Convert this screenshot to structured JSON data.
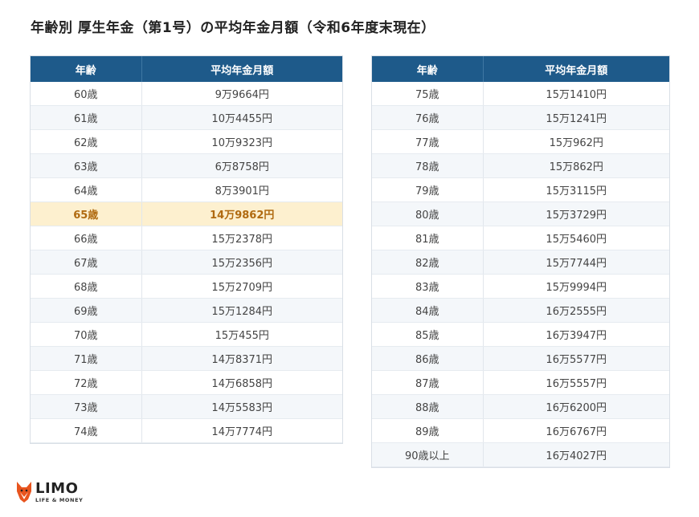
{
  "title": "年齢別 厚生年金（第1号）の平均年金月額（令和6年度末現在）",
  "headers": {
    "age": "年齢",
    "amount": "平均年金月額"
  },
  "left_table": [
    {
      "age": "60歳",
      "amount": "9万9664円"
    },
    {
      "age": "61歳",
      "amount": "10万4455円"
    },
    {
      "age": "62歳",
      "amount": "10万9323円"
    },
    {
      "age": "63歳",
      "amount": "6万8758円"
    },
    {
      "age": "64歳",
      "amount": "8万3901円"
    },
    {
      "age": "65歳",
      "amount": "14万9862円",
      "highlight": true
    },
    {
      "age": "66歳",
      "amount": "15万2378円"
    },
    {
      "age": "67歳",
      "amount": "15万2356円"
    },
    {
      "age": "68歳",
      "amount": "15万2709円"
    },
    {
      "age": "69歳",
      "amount": "15万1284円"
    },
    {
      "age": "70歳",
      "amount": "15万455円"
    },
    {
      "age": "71歳",
      "amount": "14万8371円"
    },
    {
      "age": "72歳",
      "amount": "14万6858円"
    },
    {
      "age": "73歳",
      "amount": "14万5583円"
    },
    {
      "age": "74歳",
      "amount": "14万7774円"
    }
  ],
  "right_table": [
    {
      "age": "75歳",
      "amount": "15万1410円"
    },
    {
      "age": "76歳",
      "amount": "15万1241円"
    },
    {
      "age": "77歳",
      "amount": "15万962円"
    },
    {
      "age": "78歳",
      "amount": "15万862円"
    },
    {
      "age": "79歳",
      "amount": "15万3115円"
    },
    {
      "age": "80歳",
      "amount": "15万3729円"
    },
    {
      "age": "81歳",
      "amount": "15万5460円"
    },
    {
      "age": "82歳",
      "amount": "15万7744円"
    },
    {
      "age": "83歳",
      "amount": "15万9994円"
    },
    {
      "age": "84歳",
      "amount": "16万2555円"
    },
    {
      "age": "85歳",
      "amount": "16万3947円"
    },
    {
      "age": "86歳",
      "amount": "16万5577円"
    },
    {
      "age": "87歳",
      "amount": "16万5557円"
    },
    {
      "age": "88歳",
      "amount": "16万6200円"
    },
    {
      "age": "89歳",
      "amount": "16万6767円"
    },
    {
      "age": "90歳以上",
      "amount": "16万4027円"
    }
  ],
  "logo": {
    "text": "LIMO",
    "tagline": "LIFE & MONEY",
    "icon": "fox-icon"
  },
  "colors": {
    "header_bg": "#1e5a8a",
    "header_text": "#ffffff",
    "row_alt": "#f4f7fa",
    "highlight_bg": "#fdf0cf",
    "highlight_text": "#b06a10",
    "logo_accent": "#e8541e"
  }
}
